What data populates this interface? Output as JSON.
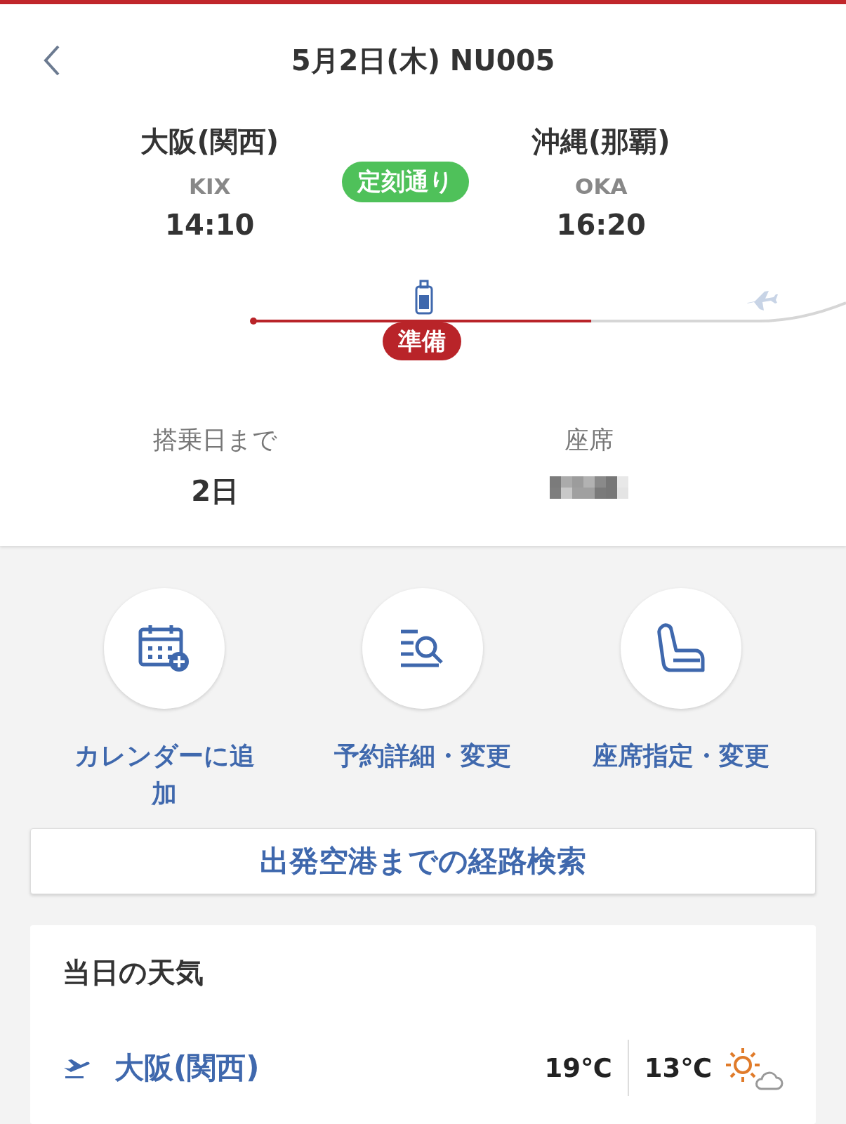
{
  "header": {
    "title": "5月2日(木) NU005"
  },
  "flight": {
    "departure": {
      "city": "大阪(関西)",
      "code": "KIX",
      "time": "14:10"
    },
    "arrival": {
      "city": "沖縄(那覇)",
      "code": "OKA",
      "time": "16:20"
    },
    "status": "定刻通り"
  },
  "progress": {
    "level": 0.57,
    "stage": "準備"
  },
  "info": [
    {
      "label": "搭乗日まで",
      "value": "2日",
      "kind": "text"
    },
    {
      "label": "座席",
      "kind": "redacted"
    }
  ],
  "actions": [
    {
      "label": "カレンダーに追加",
      "kind": "calendar"
    },
    {
      "label": "予約詳細・変更",
      "kind": "details"
    },
    {
      "label": "座席指定・変更",
      "kind": "seat"
    }
  ],
  "route_button": "出発空港までの経路検索",
  "weather": {
    "title": "当日の天気",
    "rows": [
      {
        "city": "大阪(関西)",
        "high": "19℃",
        "low": "13℃"
      }
    ]
  }
}
